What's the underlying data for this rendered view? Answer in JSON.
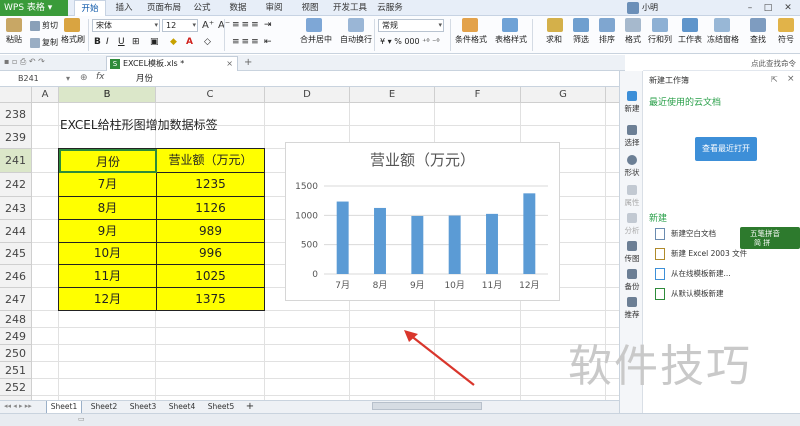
{
  "menubar": {
    "app_name": "WPS 表格",
    "tabs": [
      "开始",
      "插入",
      "页面布局",
      "公式",
      "数据",
      "审阅",
      "视图",
      "开发工具",
      "云服务"
    ],
    "user": "小明"
  },
  "ribbon": {
    "paste": "粘贴",
    "cut": "剪切",
    "copy": "复制",
    "format_painter": "格式刷",
    "font_name": "宋体",
    "font_size": "12",
    "merge_center": "合并居中",
    "wrap_text": "自动换行",
    "number_format": "常规",
    "conditional_format": "条件格式",
    "table_style": "表格样式",
    "sum": "求和",
    "filter": "筛选",
    "sort": "排序",
    "format": "格式",
    "row_col": "行和列",
    "worksheet": "工作表",
    "freeze": "冻结窗格",
    "find": "查找",
    "symbol": "符号"
  },
  "docbar": {
    "filename": "EXCEL模板.xls *"
  },
  "formula_bar": {
    "cell_ref": "B241",
    "fx": "fx",
    "content": "月份"
  },
  "columns": [
    "A",
    "B",
    "C",
    "D",
    "E",
    "F",
    "G"
  ],
  "rows": [
    "238",
    "239",
    "241",
    "242",
    "243",
    "244",
    "245",
    "246",
    "247",
    "248",
    "249",
    "250",
    "251",
    "252",
    "253"
  ],
  "sheet": {
    "title": "EXCEL给柱形图增加数据标签",
    "table_headers": [
      "月份",
      "营业额（万元）"
    ],
    "table_rows": [
      [
        "7月",
        "1235"
      ],
      [
        "8月",
        "1126"
      ],
      [
        "9月",
        "989"
      ],
      [
        "10月",
        "996"
      ],
      [
        "11月",
        "1025"
      ],
      [
        "12月",
        "1375"
      ]
    ]
  },
  "chart_data": {
    "type": "bar",
    "title": "营业额（万元）",
    "categories": [
      "7月",
      "8月",
      "9月",
      "10月",
      "11月",
      "12月"
    ],
    "values": [
      1235,
      1126,
      989,
      996,
      1025,
      1375
    ],
    "ylim": [
      0,
      1500
    ],
    "yticks": [
      "0",
      "500",
      "1000",
      "1500"
    ],
    "grid": true,
    "bar_color": "#5b9bd5"
  },
  "sheet_tabs": [
    "Sheet1",
    "Sheet2",
    "Sheet3",
    "Sheet4",
    "Sheet5"
  ],
  "sidebar": [
    "新建",
    "选择",
    "形状",
    "属性",
    "分析",
    "传图",
    "备份",
    "推荐"
  ],
  "pane": {
    "title": "新建工作簿",
    "top_link": "点此查找命令",
    "recent_heading": "最近使用的云文档",
    "recent_button": "查看最近打开",
    "new_heading": "新建",
    "items": [
      "新建空白文档",
      "新建 Excel 2003 文件",
      "从在线模板新建...",
      "从默认模板新建"
    ]
  },
  "ime": {
    "name": "五笔拼音",
    "mode": "简 拼"
  },
  "watermark": "软件技巧",
  "colors": {
    "accent_green": "#3a9b3a",
    "highlight_yellow": "#ffff00",
    "link_green": "#2aa04a",
    "arrow_red": "#d9362c"
  }
}
